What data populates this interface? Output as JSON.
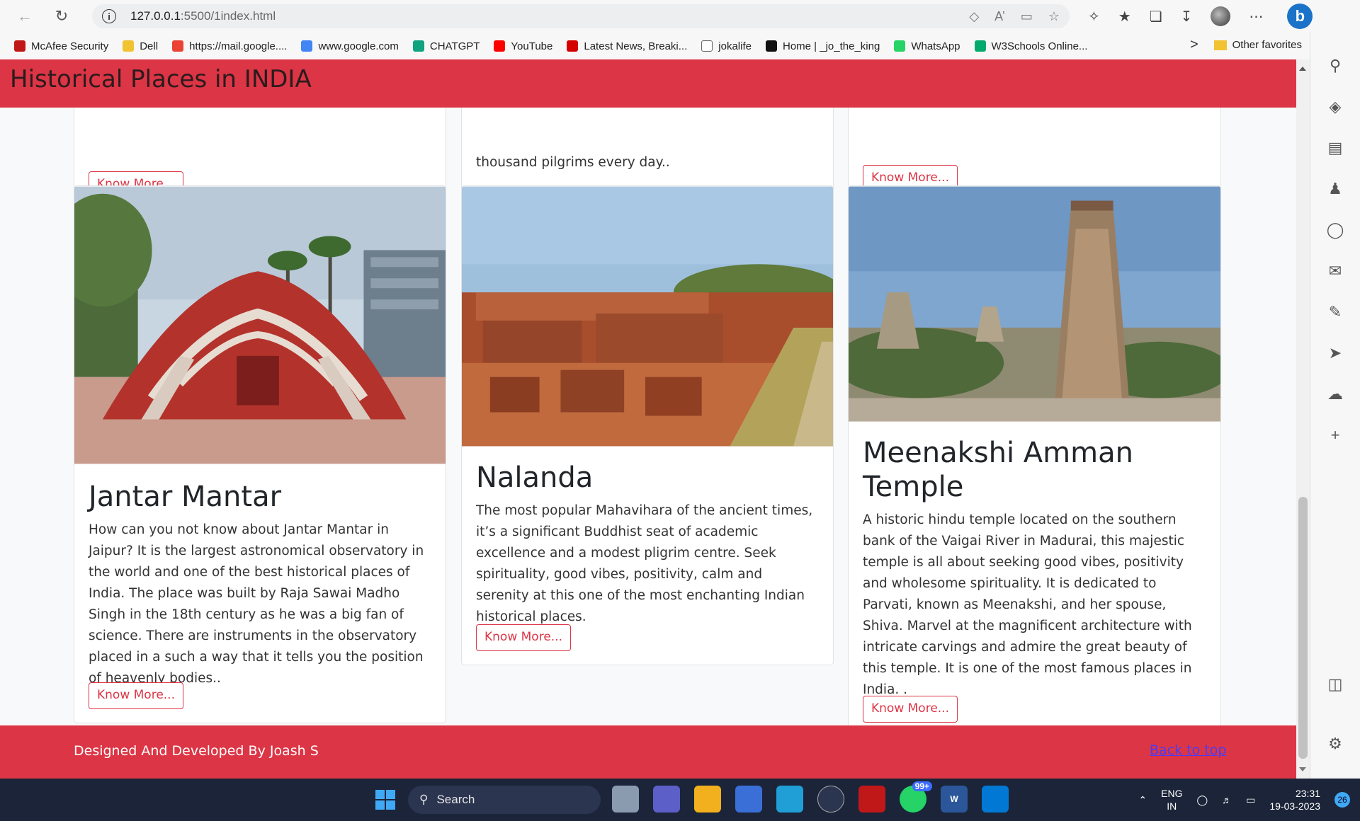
{
  "browser": {
    "url_host": "127.0.0.1",
    "url_path": ":5500/1index.html",
    "favorites": [
      {
        "label": "McAfee Security",
        "color": "#c01818"
      },
      {
        "label": "Dell",
        "color": "#f1c232"
      },
      {
        "label": "https://mail.google....",
        "color": "#ea4335"
      },
      {
        "label": "www.google.com",
        "color": "#4285f4"
      },
      {
        "label": "CHATGPT",
        "color": "#10a37f"
      },
      {
        "label": "YouTube",
        "color": "#ff0000"
      },
      {
        "label": "Latest News, Breaki...",
        "color": "#d40000"
      },
      {
        "label": "jokalife",
        "color": "#ffffff"
      },
      {
        "label": "Home | _jo_the_king",
        "color": "#111111"
      },
      {
        "label": "WhatsApp",
        "color": "#25d366"
      },
      {
        "label": "W3Schools Online...",
        "color": "#04aa6d"
      }
    ],
    "other_favorites": "Other favorites",
    "more_icon": ">"
  },
  "site": {
    "title": "Historical Places in INDIA",
    "accent_color": "#dc3545",
    "partial_text": "thousand pilgrims every day..",
    "know_more_label": "Know More...",
    "cards": [
      {
        "title": "Jantar Mantar",
        "text": "How can you not know about Jantar Mantar in Jaipur? It is the largest astronomical observatory in the world and one of the best historical places of India. The place was built by Raja Sawai Madho Singh in the 18th century as he was a big fan of science. There are instruments in the observatory placed in a such a way that it tells you the position of heavenly bodies.."
      },
      {
        "title": "Nalanda",
        "text": "The most popular Mahavihara of the ancient times, it’s a significant Buddhist seat of academic excellence and a modest pligrim centre. Seek spirituality, good vibes, positivity, calm and serenity at this one of the most enchanting Indian historical places."
      },
      {
        "title": "Meenakshi Amman Temple",
        "text": "A historic hindu temple located on the southern bank of the Vaigai River in Madurai, this majestic temple is all about seeking good vibes, positivity and wholesome spirituality. It is dedicated to Parvati, known as Meenakshi, and her spouse, Shiva. Marvel at the magnificent architecture with intricate carvings and admire the great beauty of this temple. It is one of the most famous places in India. ."
      }
    ],
    "footer_credit": "Designed And Developed By Joash S",
    "back_to_top": "Back to top"
  },
  "taskbar": {
    "search_label": "Search",
    "whatsapp_badge": "99+",
    "lang_top": "ENG",
    "lang_bottom": "IN",
    "time": "23:31",
    "date": "19-03-2023",
    "notifications": "26"
  }
}
